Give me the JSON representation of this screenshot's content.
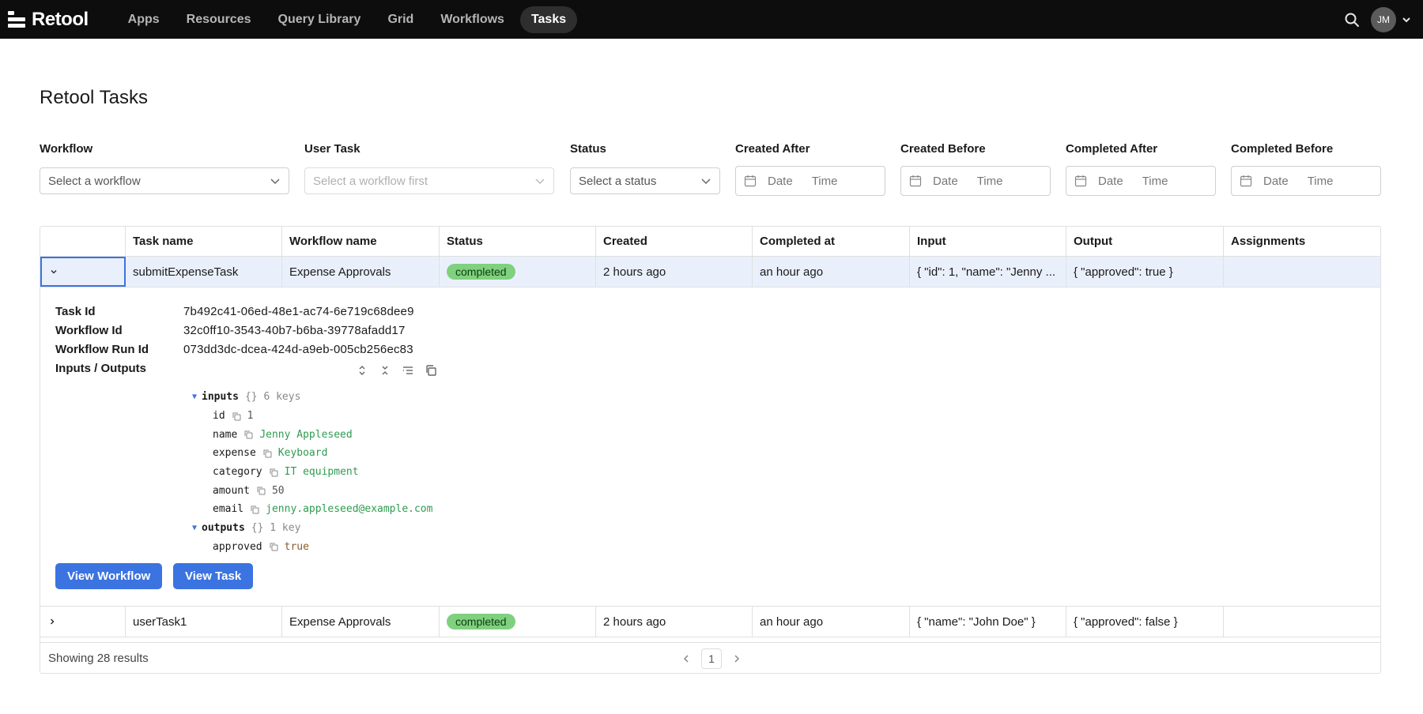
{
  "nav": {
    "logo": "Retool",
    "links": [
      "Apps",
      "Resources",
      "Query Library",
      "Grid",
      "Workflows",
      "Tasks"
    ],
    "active": "Tasks",
    "avatar": "JM"
  },
  "page": {
    "title": "Retool Tasks"
  },
  "filters": {
    "workflow": {
      "label": "Workflow",
      "placeholder": "Select a workflow"
    },
    "user_task": {
      "label": "User Task",
      "placeholder": "Select a workflow first"
    },
    "status": {
      "label": "Status",
      "placeholder": "Select a status"
    },
    "created_after": {
      "label": "Created After",
      "date": "Date",
      "time": "Time"
    },
    "created_before": {
      "label": "Created Before",
      "date": "Date",
      "time": "Time"
    },
    "completed_after": {
      "label": "Completed After",
      "date": "Date",
      "time": "Time"
    },
    "completed_before": {
      "label": "Completed Before",
      "date": "Date",
      "time": "Time"
    }
  },
  "table": {
    "columns": [
      "",
      "Task name",
      "Workflow name",
      "Status",
      "Created",
      "Completed at",
      "Input",
      "Output",
      "Assignments"
    ],
    "rows": [
      {
        "task_name": "submitExpenseTask",
        "workflow_name": "Expense Approvals",
        "status": "completed",
        "created": "2 hours ago",
        "completed_at": "an hour ago",
        "input": "{ \"id\": 1, \"name\": \"Jenny ...",
        "output": "{ \"approved\": true }",
        "assignments": ""
      },
      {
        "task_name": "userTask1",
        "workflow_name": "Expense Approvals",
        "status": "completed",
        "created": "2 hours ago",
        "completed_at": "an hour ago",
        "input": "{ \"name\": \"John Doe\" }",
        "output": "{ \"approved\": false }",
        "assignments": ""
      }
    ],
    "detail": {
      "task_id_label": "Task Id",
      "task_id": "7b492c41-06ed-48e1-ac74-6e719c68dee9",
      "workflow_id_label": "Workflow Id",
      "workflow_id": "32c0ff10-3543-40b7-b6ba-39778afadd17",
      "workflow_run_id_label": "Workflow Run Id",
      "workflow_run_id": "073dd3dc-dcea-424d-a9eb-005cb256ec83",
      "io_label": "Inputs / Outputs",
      "inputs_key": "inputs",
      "inputs_meta": "{}  6 keys",
      "inputs": [
        {
          "key": "id",
          "value": "1",
          "type": "num"
        },
        {
          "key": "name",
          "value": "Jenny Appleseed",
          "type": "str"
        },
        {
          "key": "expense",
          "value": "Keyboard",
          "type": "str"
        },
        {
          "key": "category",
          "value": "IT equipment",
          "type": "str"
        },
        {
          "key": "amount",
          "value": "50",
          "type": "num"
        },
        {
          "key": "email",
          "value": "jenny.appleseed@example.com",
          "type": "str"
        }
      ],
      "outputs_key": "outputs",
      "outputs_meta": "{}  1 key",
      "outputs": [
        {
          "key": "approved",
          "value": "true",
          "type": "bool"
        }
      ],
      "view_workflow": "View Workflow",
      "view_task": "View Task"
    },
    "footer": {
      "results": "Showing 28 results",
      "page": "1"
    }
  },
  "colors": {
    "accent": "#3b73e0",
    "status_completed": "#7fd07f",
    "nav_bg": "#0d0d0d"
  }
}
